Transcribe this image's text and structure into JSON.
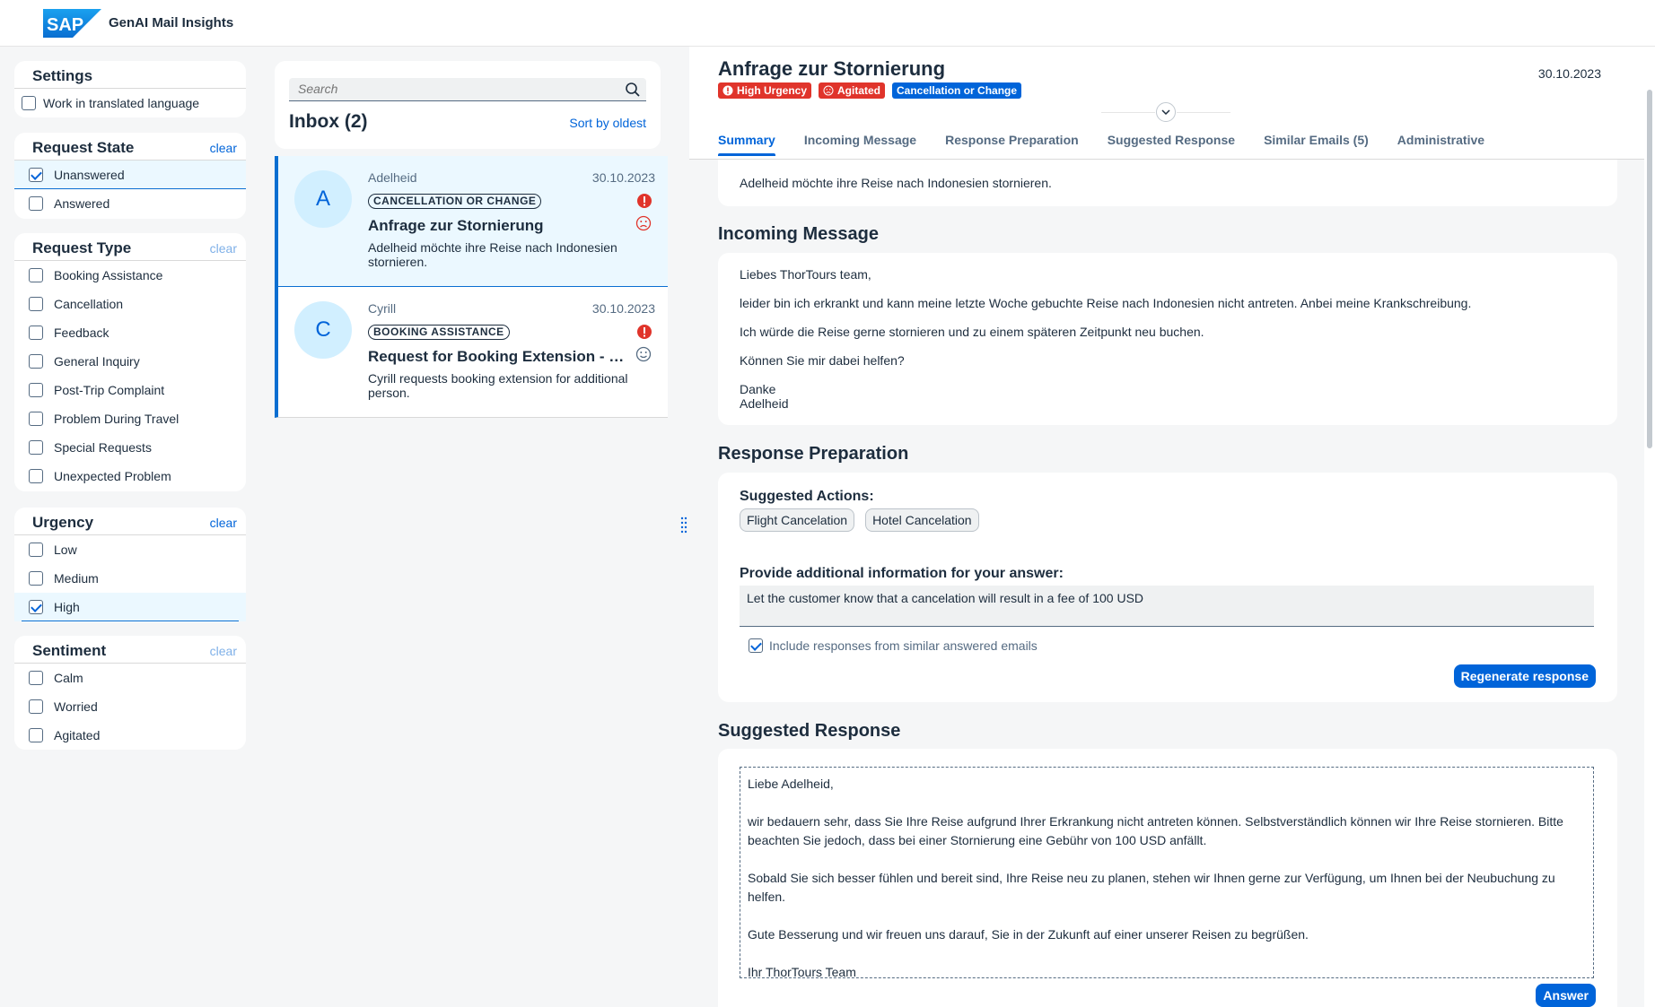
{
  "app": {
    "title": "GenAI Mail Insights"
  },
  "settings": {
    "title": "Settings",
    "translated_label": "Work in translated language"
  },
  "filters": {
    "request_state": {
      "title": "Request State",
      "clear": "clear",
      "options": [
        "Unanswered",
        "Answered"
      ]
    },
    "request_type": {
      "title": "Request Type",
      "clear": "clear",
      "options": [
        "Booking Assistance",
        "Cancellation",
        "Feedback",
        "General Inquiry",
        "Post-Trip Complaint",
        "Problem During Travel",
        "Special Requests",
        "Unexpected Problem"
      ]
    },
    "urgency": {
      "title": "Urgency",
      "clear": "clear",
      "options": [
        "Low",
        "Medium",
        "High"
      ]
    },
    "sentiment": {
      "title": "Sentiment",
      "clear": "clear",
      "options": [
        "Calm",
        "Worried",
        "Agitated"
      ]
    }
  },
  "inbox": {
    "search_placeholder": "Search",
    "title": "Inbox (2)",
    "sort_label": "Sort by oldest",
    "items": [
      {
        "initial": "A",
        "sender": "Adelheid",
        "date": "30.10.2023",
        "tag": "CANCELLATION OR CHANGE",
        "subject": "Anfrage zur Stornierung",
        "preview": "Adelheid möchte ihre Reise nach Indonesien stornieren."
      },
      {
        "initial": "C",
        "sender": "Cyrill",
        "date": "30.10.2023",
        "tag": "BOOKING ASSISTANCE",
        "subject": "Request for Booking Extension - Group Trip",
        "preview": "Cyrill requests booking extension for additional person."
      }
    ]
  },
  "detail": {
    "title": "Anfrage zur Stornierung",
    "date": "30.10.2023",
    "badges": {
      "urgency": "High Urgency",
      "sentiment": "Agitated",
      "category": "Cancellation or Change"
    },
    "tabs": [
      "Summary",
      "Incoming Message",
      "Response Preparation",
      "Suggested Response",
      "Similar Emails (5)",
      "Administrative"
    ],
    "summary": "Adelheid möchte ihre Reise nach Indonesien stornieren.",
    "incoming": {
      "title": "Incoming Message",
      "greeting": "Liebes ThorTours team,",
      "line1": "leider bin ich erkrankt und kann meine letzte Woche gebuchte Reise nach Indonesien nicht antreten. Anbei meine Krankschreibung.",
      "line2": "Ich würde die Reise gerne stornieren und zu einem späteren Zeitpunkt neu buchen.",
      "line3": "Können Sie mir dabei helfen?",
      "closing": "Danke",
      "name": "Adelheid"
    },
    "preparation": {
      "title": "Response Preparation",
      "actions_label": "Suggested Actions:",
      "actions": [
        "Flight Cancelation",
        "Hotel Cancelation"
      ],
      "info_label": "Provide additional information for your answer:",
      "info_value": "Let the customer know that a cancelation will result in a fee of 100 USD",
      "include_label": "Include responses from similar answered emails",
      "regenerate": "Regenerate response"
    },
    "suggested": {
      "title": "Suggested Response",
      "p1": "Liebe Adelheid,",
      "p2": "wir bedauern sehr, dass Sie Ihre Reise aufgrund Ihrer Erkrankung nicht antreten können. Selbstverständlich können wir Ihre Reise stornieren. Bitte beachten Sie jedoch, dass bei einer Stornierung eine Gebühr von 100 USD anfällt.",
      "p3": "Sobald Sie sich besser fühlen und bereit sind, Ihre Reise neu zu planen, stehen wir Ihnen gerne zur Verfügung, um Ihnen bei der Neubuchung zu helfen.",
      "p4": "Gute Besserung und wir freuen uns darauf, Sie in der Zukunft auf einer unserer Reisen zu begrüßen.",
      "p5": "Ihr ThorTours Team",
      "answer": "Answer"
    }
  },
  "colors": {
    "brand": "#0064d9",
    "urgent": "#e0342b",
    "selected_bg": "#ebf8ff"
  }
}
